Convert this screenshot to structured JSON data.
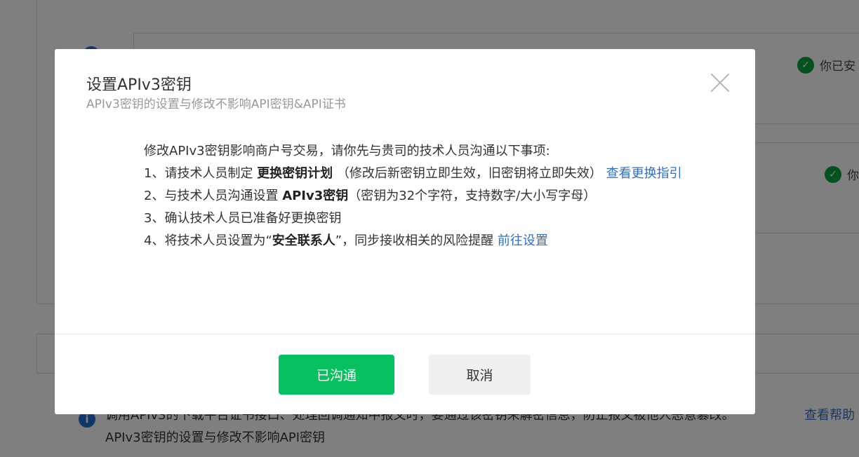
{
  "background": {
    "status_1": "你已安",
    "status_2": "你",
    "info_text": "调用APIv3的下载平台证书接口、处理回调通知中报文时，要通过该密钥来解密信息，防止报文被他人恶意篡改。",
    "info_link": "查看帮助",
    "info_text_2": "APIv3密钥的设置与修改不影响API密钥"
  },
  "modal": {
    "title": "设置APIv3密钥",
    "subtitle": "APIv3密钥的设置与修改不影响API密钥&API证书",
    "intro": "修改APIv3密钥影响商户号交易，请你先与贵司的技术人员沟通以下事项:",
    "item1_prefix": "1、请技术人员制定 ",
    "item1_bold": "更换密钥计划",
    "item1_suffix": " （修改后新密钥立即生效，旧密钥将立即失效）",
    "item1_link": "查看更换指引",
    "item2_prefix": "2、与技术人员沟通设置 ",
    "item2_bold": "APIv3密钥",
    "item2_suffix": "（密钥为32个字符，支持数字/大小写字母）",
    "item3": "3、确认技术人员已准备好更换密钥",
    "item4_prefix": "4、将技术人员设置为“",
    "item4_bold": "安全联系人",
    "item4_suffix": "”，同步接收相关的风险提醒 ",
    "item4_link": "前往设置",
    "confirm_label": "已沟通",
    "cancel_label": "取消"
  },
  "colors": {
    "primary": "#07c160",
    "link": "#2f6fc8",
    "success": "#07a33f"
  }
}
